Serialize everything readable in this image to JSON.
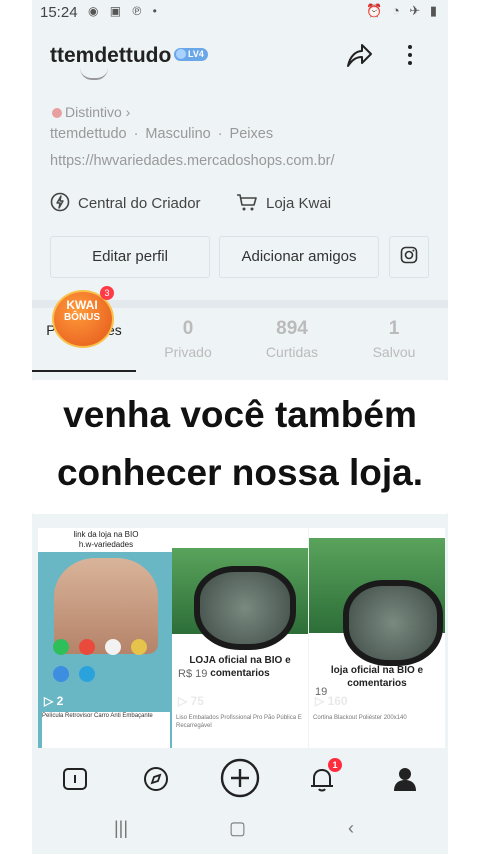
{
  "status_bar": {
    "time": "15:24"
  },
  "profile": {
    "username": "ttemdettudo",
    "level_badge": "LV4",
    "distintivo": "Distintivo ›",
    "info": [
      "ttemdettudo",
      "Masculino",
      "Peixes"
    ],
    "separator": "·",
    "url": "https://hwvariedades.mercadoshops.com.br/",
    "creator_center": "Central do Criador",
    "kwai_store": "Loja Kwai",
    "edit_profile": "Editar perfil",
    "add_friends": "Adicionar amigos"
  },
  "bonus": {
    "line1": "KWAI",
    "line2": "BÔNUS",
    "count": "3"
  },
  "stats": {
    "publications": {
      "label": "Publicações",
      "value": ""
    },
    "private": {
      "value": "0",
      "label": "Privado"
    },
    "liked": {
      "value": "894",
      "label": "Curtidas"
    },
    "saved": {
      "value": "1",
      "label": "Salvou"
    }
  },
  "overlay": {
    "line1": "venha você também",
    "line2": "conhecer nossa loja."
  },
  "grid": [
    {
      "caption_top": "link da loja na BIO\nh.w-variedades",
      "plays": "2",
      "footer": "Película Retrovisor Carro Anti Embaçante"
    },
    {
      "caption": "LOJA oficial na BIO e comentarios",
      "price": "R$ 19",
      "plays": "75",
      "footer": "Liso Embalados Profissional Pro Pão Pública E Recarregável"
    },
    {
      "caption": "loja oficial na BIO e comentarios",
      "price": "19",
      "plays": "160",
      "footer": "Cortina Blackout Poliéster 200x140"
    }
  ],
  "nav": {
    "notifications_count": "1"
  },
  "colors": {
    "accent_badge": "#ff2d3d",
    "level_badge": "#6aa7e8",
    "bonus": "#e4571b"
  }
}
